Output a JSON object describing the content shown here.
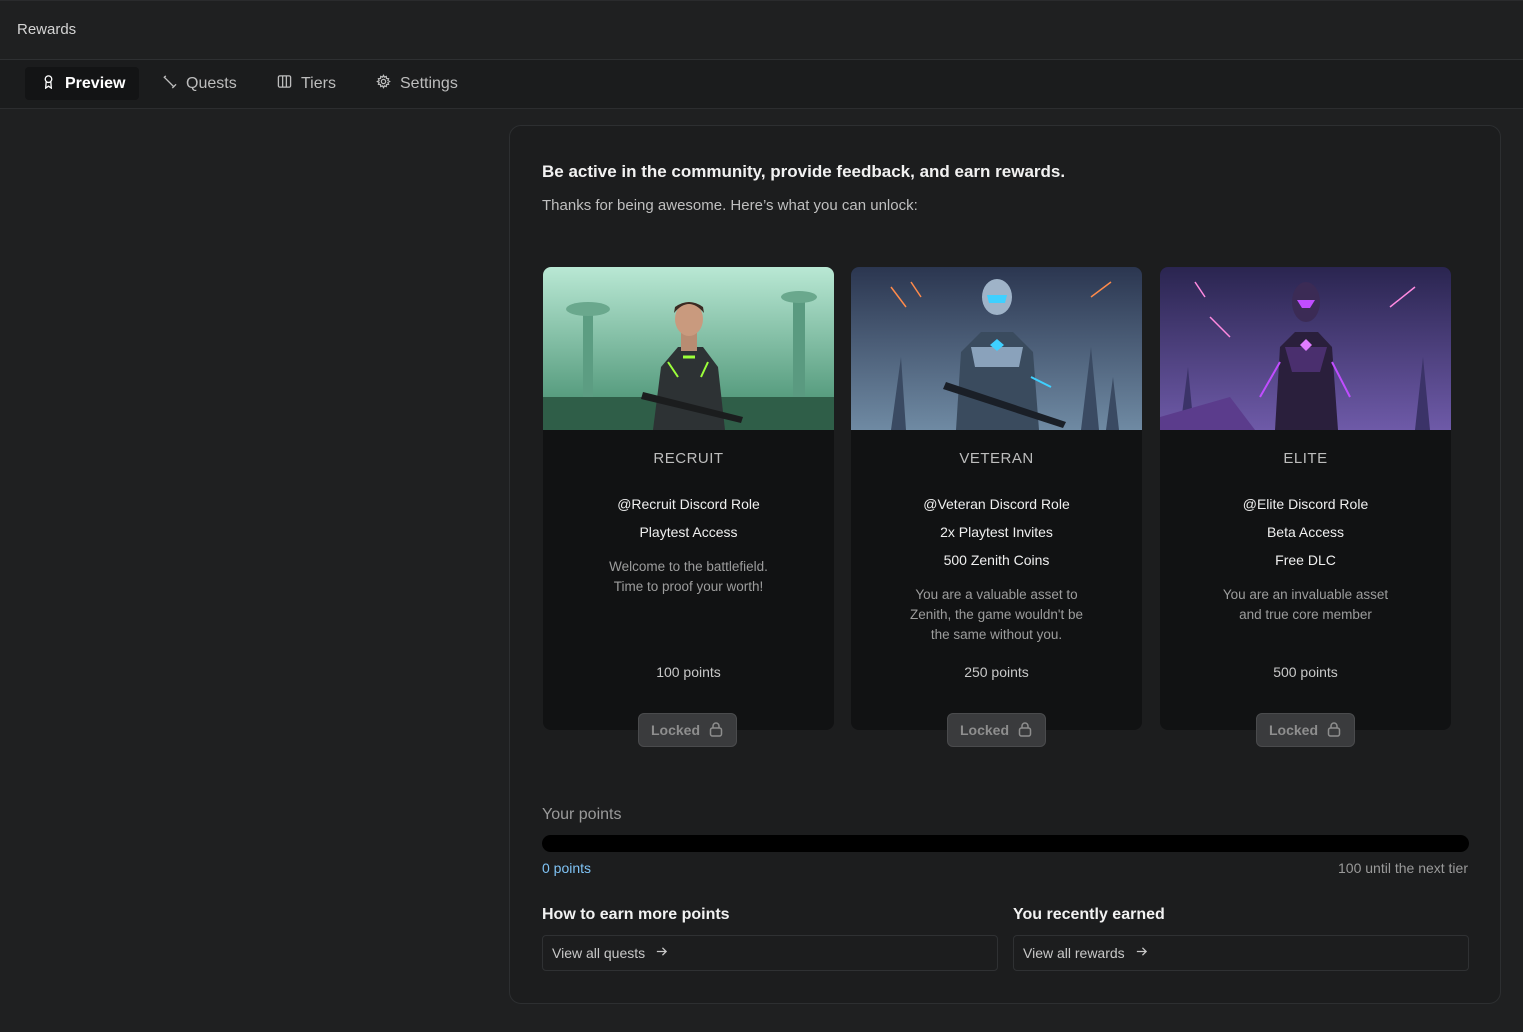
{
  "window": {
    "title": "Rewards"
  },
  "tabs": [
    {
      "label": "Preview",
      "icon": "award-icon",
      "active": true
    },
    {
      "label": "Quests",
      "icon": "pen-icon",
      "active": false
    },
    {
      "label": "Tiers",
      "icon": "columns-icon",
      "active": false
    },
    {
      "label": "Settings",
      "icon": "gear-icon",
      "active": false
    }
  ],
  "panel": {
    "headline": "Be active in the community, provide feedback, and earn rewards.",
    "subline": "Thanks for being awesome. Here’s what you can unlock:"
  },
  "tiers": [
    {
      "name": "RECRUIT",
      "perks": [
        "@Recruit Discord Role",
        "Playtest Access"
      ],
      "description": "Welcome to the battlefield. Time to proof your worth!",
      "points": "100 points",
      "status": "Locked",
      "accent": "#9cff3a"
    },
    {
      "name": "VETERAN",
      "perks": [
        "@Veteran Discord Role",
        "2x Playtest Invites",
        "500 Zenith Coins"
      ],
      "description": "You are a valuable asset to Zenith, the game wouldn't be the same without you.",
      "points": "250 points",
      "status": "Locked",
      "accent": "#3fd0ff"
    },
    {
      "name": "ELITE",
      "perks": [
        "@Elite Discord Role",
        "Beta Access",
        "Free DLC"
      ],
      "description": "You are an invaluable asset and true core member",
      "points": "500 points",
      "status": "Locked",
      "accent": "#c04dff"
    }
  ],
  "progress": {
    "label": "Your points",
    "current": "0 points",
    "fraction": 0,
    "next_tier": "100 until the next tier"
  },
  "earn": {
    "title": "How to earn more points",
    "link": "View all quests"
  },
  "recent": {
    "title": "You recently earned",
    "link": "View all rewards"
  },
  "colors": {
    "accent_blue": "#7fc3f5",
    "background": "#1f2021",
    "card": "#1c1d1e"
  }
}
